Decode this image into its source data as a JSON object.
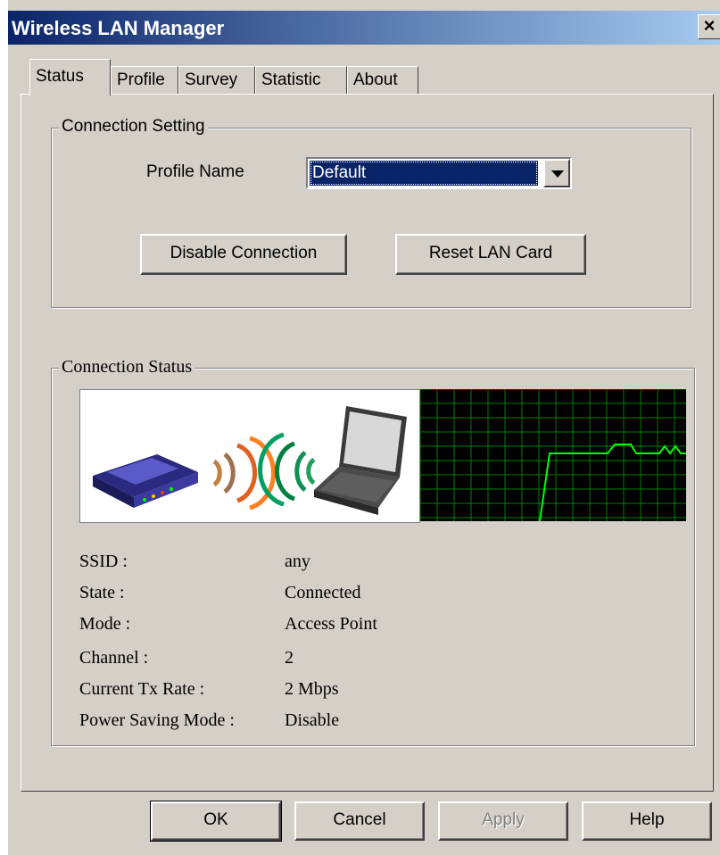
{
  "window": {
    "title": "Wireless LAN Manager",
    "close_label": "×"
  },
  "tabs": [
    {
      "label": "Status"
    },
    {
      "label": "Profile"
    },
    {
      "label": "Survey"
    },
    {
      "label": "Statistic"
    },
    {
      "label": "About"
    }
  ],
  "connection_setting": {
    "group_title": "Connection Setting",
    "profile_name_label": "Profile Name",
    "profile_name_value": "Default",
    "disable_connection_label": "Disable Connection",
    "reset_lan_card_label": "Reset LAN Card"
  },
  "connection_status": {
    "group_title": "Connection Status",
    "graph_color": "#00ff00",
    "fields": [
      {
        "label": "SSID :",
        "value": "any"
      },
      {
        "label": "State :",
        "value": "Connected"
      },
      {
        "label": "Mode :",
        "value": "Access Point"
      },
      {
        "label": "Channel :",
        "value": "2"
      },
      {
        "label": "Current Tx Rate :",
        "value": "2 Mbps"
      },
      {
        "label": "Power Saving Mode :",
        "value": "Disable"
      }
    ]
  },
  "buttons": {
    "ok": "OK",
    "cancel": "Cancel",
    "apply": "Apply",
    "help": "Help"
  },
  "icons": [
    "router-icon",
    "orange-signal-waves-icon",
    "green-signal-waves-icon",
    "laptop-icon",
    "signal-graph"
  ]
}
